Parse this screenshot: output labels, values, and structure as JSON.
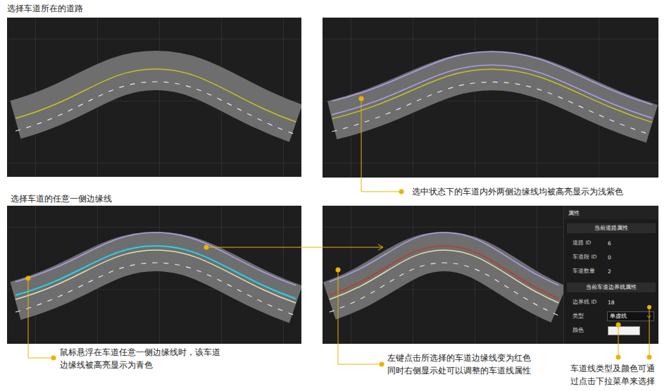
{
  "captions": [
    "选择车道所在的道路",
    "选择车道的任意一侧边缘线"
  ],
  "viewports": [
    {
      "kind": "plain"
    },
    {
      "kind": "road-selected"
    },
    {
      "kind": "edge-hover"
    },
    {
      "kind": "edge-clicked"
    }
  ],
  "callouts": [
    {
      "lines": [
        "选中状态下的车道内外两侧边缘线均被高亮显示为浅紫色"
      ]
    },
    {
      "lines": [
        "鼠标悬浮在车道任意一侧边缘线时，该车道边缘线被高亮显示为青色"
      ]
    },
    {
      "lines": [
        "左键点击所选择的车道边缘线变为红色",
        "同时右侧显示处可以调整的车道线属性"
      ]
    },
    {
      "lines": [
        "车道线类型及颜色可通过点击下拉菜单来选择"
      ]
    }
  ],
  "properties": {
    "title": "属性",
    "sections": [
      {
        "title": "当前道路属性",
        "rows": [
          {
            "label": "道路 ID",
            "kind": "text",
            "value": "6"
          },
          {
            "label": "车道段 ID",
            "kind": "text",
            "value": "0"
          },
          {
            "label": "车道数量",
            "kind": "text",
            "value": "2"
          }
        ]
      },
      {
        "title": "当前车道边界线属性",
        "rows": [
          {
            "label": "边界线 ID",
            "kind": "text",
            "value": "18"
          },
          {
            "label": "类型",
            "kind": "dropdown",
            "value": "单虚线"
          },
          {
            "label": "颜色",
            "kind": "color",
            "value": "",
            "color": "#f2f2f2"
          }
        ]
      }
    ]
  }
}
